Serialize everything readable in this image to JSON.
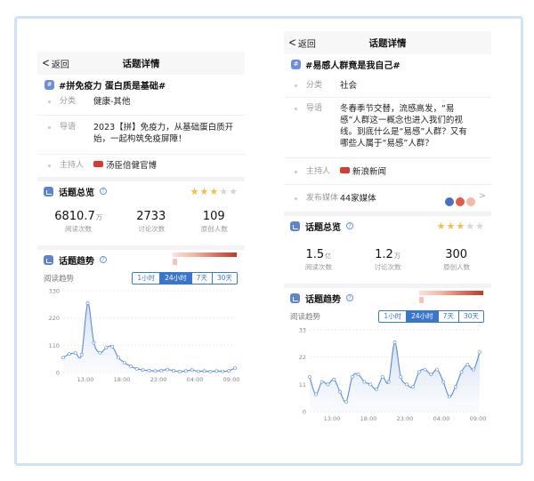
{
  "panels": [
    {
      "nav": {
        "back": "返回",
        "title": "话题详情"
      },
      "topic": "#拼免疫力 蛋白质是基础#",
      "info": [
        {
          "label": "分类",
          "value": "健康-其他"
        },
        {
          "label": "导语",
          "value": "2023【拼】免疫力，从基础蛋白质开始，一起构筑免疫屏障！"
        },
        {
          "label": "主持人",
          "value": "汤臣倍健官博"
        }
      ],
      "overview": {
        "title": "话题总览",
        "rating": 2.5,
        "stats": [
          {
            "num": "6810.7",
            "unit": "万",
            "caption": "阅读次数"
          },
          {
            "num": "2733",
            "unit": "",
            "caption": "讨论次数"
          },
          {
            "num": "109",
            "unit": "",
            "caption": "原创人数"
          }
        ]
      },
      "trend": {
        "title": "话题趋势",
        "sub_label": "阅读趋势",
        "tabs": [
          "1小时",
          "24小时",
          "7天",
          "30天"
        ],
        "active_tab": "24小时"
      }
    },
    {
      "nav": {
        "back": "返回",
        "title": "话题详情"
      },
      "topic": "#易感人群竟是我自己#",
      "info": [
        {
          "label": "分类",
          "value": "社会"
        },
        {
          "label": "导语",
          "value": "冬春季节交替，流感高发，“易感”人群这一概念也进入我们的视线。到底什么是“易感”人群？又有哪些人属于“易感”人群？"
        },
        {
          "label": "主持人",
          "value": "新浪新闻"
        },
        {
          "label": "发布媒体",
          "value": "44家媒体"
        }
      ],
      "overview": {
        "title": "话题总览",
        "rating": 3,
        "stats": [
          {
            "num": "1.5",
            "unit": "亿",
            "caption": "阅读次数"
          },
          {
            "num": "1.2",
            "unit": "万",
            "caption": "讨论次数"
          },
          {
            "num": "300",
            "unit": "",
            "caption": "原创人数"
          }
        ]
      },
      "trend": {
        "title": "话题趋势",
        "sub_label": "阅读趋势",
        "tabs": [
          "1小时",
          "24小时",
          "7天",
          "30天"
        ],
        "active_tab": "24小时"
      }
    }
  ],
  "chart_data": [
    {
      "type": "area",
      "title": "",
      "x_ticks": [
        "13:00",
        "18:00",
        "23:00",
        "04:00",
        "09:00"
      ],
      "y_ticks": [
        0,
        110,
        220,
        330
      ],
      "ylim": [
        0,
        330
      ],
      "values": [
        60,
        75,
        78,
        72,
        280,
        120,
        80,
        100,
        105,
        60,
        40,
        25,
        15,
        10,
        8,
        6,
        8,
        12,
        7,
        4,
        6,
        10,
        5,
        6,
        4,
        6,
        5,
        7,
        18
      ],
      "line_color": "#5b8bd4"
    },
    {
      "type": "area",
      "title": "",
      "x_ticks": [
        "13:00",
        "18:00",
        "23:00",
        "04:00",
        "09:00"
      ],
      "y_ticks": [
        0,
        11,
        22,
        33
      ],
      "ylim": [
        0,
        33
      ],
      "values": [
        14,
        7,
        12,
        11,
        13,
        8,
        4,
        14,
        15,
        12,
        11,
        9,
        14,
        12,
        28,
        14,
        11,
        10,
        16,
        17,
        15,
        17,
        12,
        6,
        10,
        16,
        19,
        17,
        24
      ],
      "line_color": "#5b8bd4"
    }
  ]
}
